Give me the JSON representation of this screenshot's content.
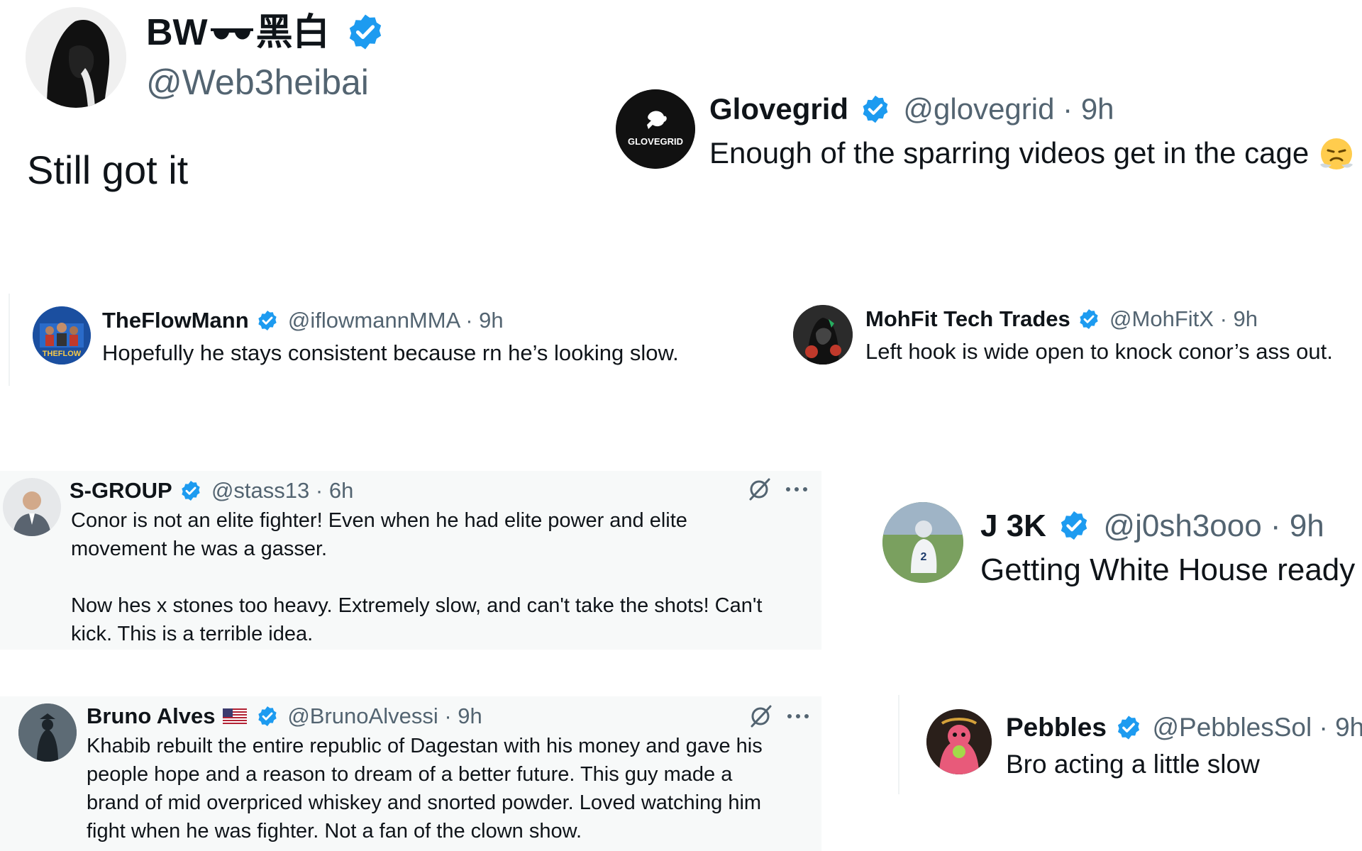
{
  "colors": {
    "verified": "#1d9bf0",
    "text": "#0f1419",
    "muted": "#536471",
    "shaded_bg": "#f7f9f9"
  },
  "tweets": [
    {
      "name": "BW",
      "name_suffix": "黑白",
      "handle": "@Web3heibai",
      "body": "Still got it"
    },
    {
      "name": "Glovegrid",
      "handle": "@glovegrid",
      "time": "9h",
      "body": "Enough of the sparring videos get in the cage",
      "emoji": "face-with-steam-from-nose",
      "avatar_text": "GLOVEGRID"
    },
    {
      "name": "TheFlowMann",
      "handle": "@iflowmannMMA",
      "time": "9h",
      "body": "Hopefully he stays consistent because rn he’s looking slow.",
      "avatar_text": "THEFLOW"
    },
    {
      "name": "MohFit Tech Trades",
      "handle": "@MohFitX",
      "time": "9h",
      "body": "Left hook is wide open to knock conor’s ass out."
    },
    {
      "name": "S-GROUP",
      "handle": "@stass13",
      "time": "6h",
      "body_lines": [
        "Conor is not an elite fighter! Even when he had elite power and elite",
        "movement he was a gasser.",
        "",
        "Now hes x stones too heavy. Extremely slow, and can't take the shots! Can't",
        "kick.  This is a terrible idea."
      ]
    },
    {
      "name": "J 3K",
      "handle": "@j0sh3ooo",
      "time": "9h",
      "body": "Getting White House ready"
    },
    {
      "name": "Bruno Alves",
      "handle": "@BrunoAlvessi",
      "time": "9h",
      "flag": "us-flag",
      "body_lines": [
        "Khabib rebuilt the entire republic of Dagestan with his money and gave his",
        "people hope and a reason to dream of a better future. This guy made a",
        "brand of mid overpriced whiskey and snorted powder. Loved watching him",
        "fight when he was fighter. Not a fan of the clown show."
      ]
    },
    {
      "name": "Pebbles",
      "handle": "@PebblesSol",
      "time": "9h",
      "body": "Bro acting a little slow"
    }
  ],
  "sep": "·"
}
